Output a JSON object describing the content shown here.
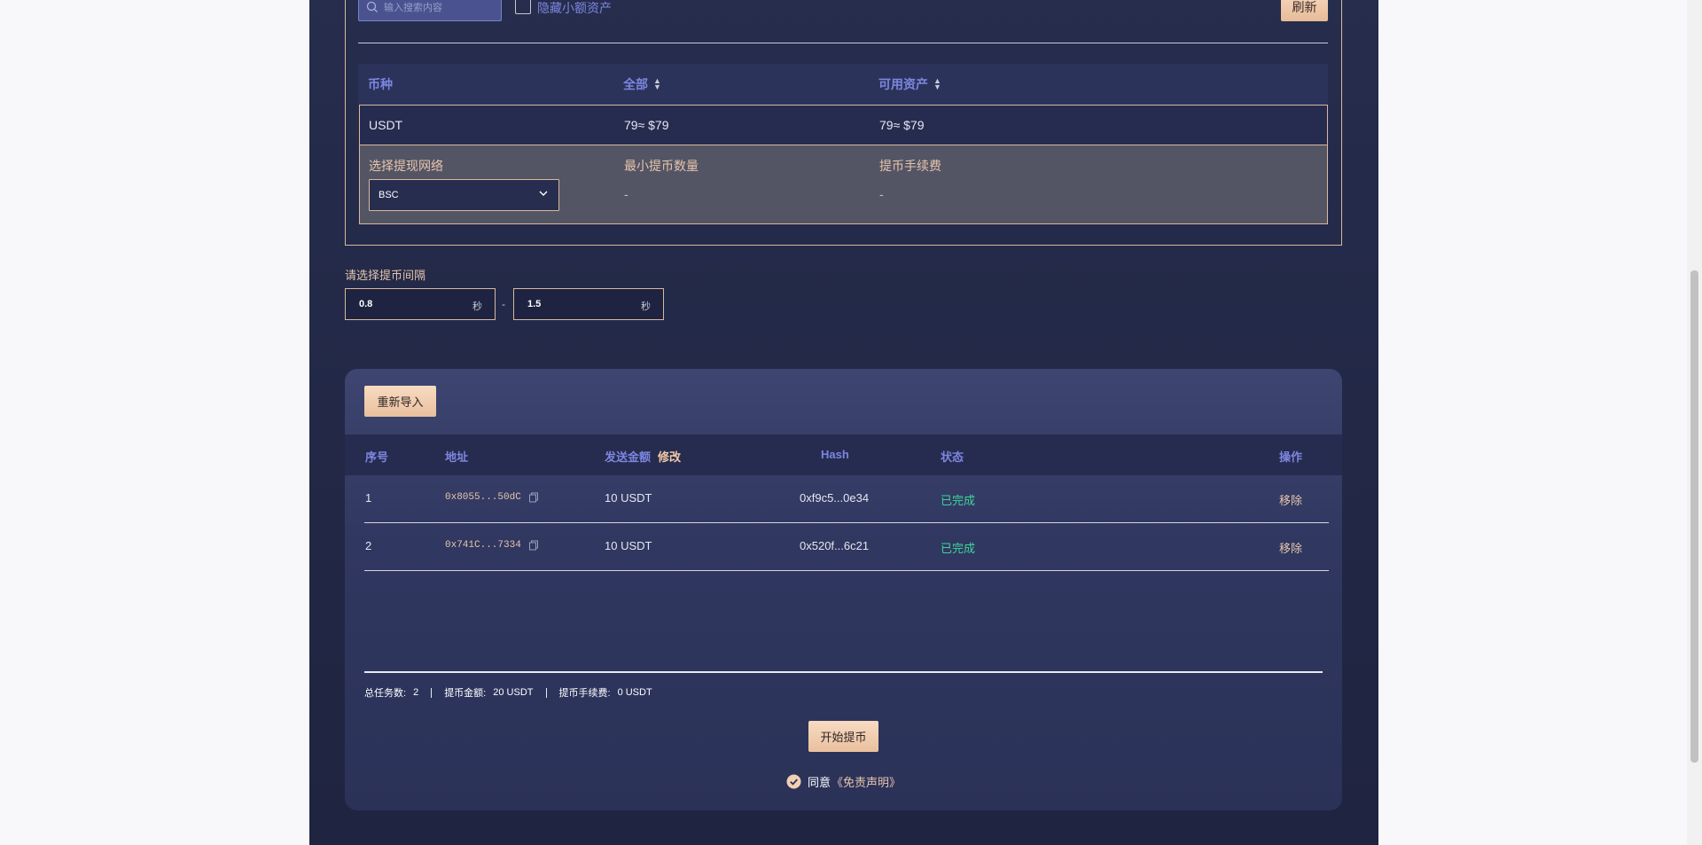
{
  "toolbar": {
    "search_placeholder": "输入搜索内容",
    "hide_small_label": "隐藏小额资产",
    "refresh_label": "刷新"
  },
  "assets": {
    "columns": [
      "币种",
      "全部",
      "可用资产"
    ],
    "row": {
      "coin": "USDT",
      "total": "79≈ $79",
      "available": "79≈ $79"
    },
    "detail": {
      "network_label": "选择提现网络",
      "network_value": "BSC",
      "min_label": "最小提币数量",
      "min_value": "-",
      "fee_label": "提币手续费",
      "fee_value": "-"
    }
  },
  "interval": {
    "label": "请选择提币间隔",
    "min": "0.8",
    "max": "1.5",
    "unit": "秒",
    "separator": "-"
  },
  "tasks": {
    "reimport_label": "重新导入",
    "columns": {
      "index": "序号",
      "address": "地址",
      "amount": "发送金额",
      "edit": "修改",
      "hash": "Hash",
      "status": "状态",
      "action": "操作"
    },
    "rows": [
      {
        "index": "1",
        "address": "0x8055...50dC",
        "amount": "10 USDT",
        "hash": "0xf9c5...0e34",
        "status": "已完成",
        "action": "移除"
      },
      {
        "index": "2",
        "address": "0x741C...7334",
        "amount": "10 USDT",
        "hash": "0x520f...6c21",
        "status": "已完成",
        "action": "移除"
      }
    ],
    "summary": {
      "total_tasks_label": "总任务数:",
      "total_tasks": "2",
      "amount_label": "提币金额:",
      "amount": "20 USDT",
      "fee_label": "提币手续费:",
      "fee": "0 USDT"
    },
    "start_label": "开始提币",
    "agree_label": "同意",
    "disclaimer_label": "《免责声明》"
  },
  "colors": {
    "accent": "#e9c09e",
    "header_text": "#7c86e0",
    "success": "#3ed598",
    "border": "#d9b89e"
  }
}
